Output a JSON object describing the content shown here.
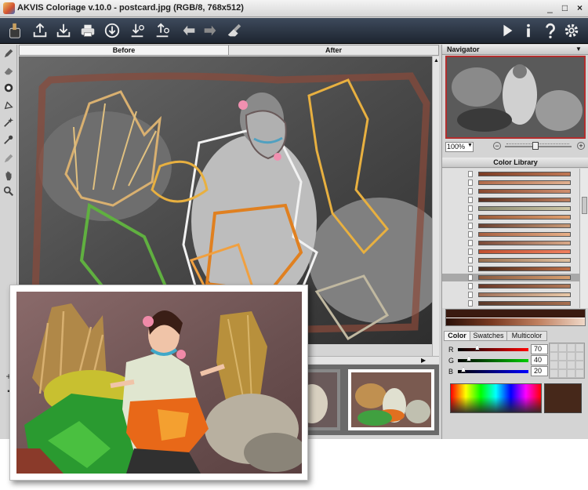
{
  "window": {
    "title": "AKVIS Coloriage v.10.0 - postcard.jpg (RGB/8, 768x512)",
    "controls": [
      "_",
      "□",
      "×"
    ]
  },
  "toolbar": {
    "buttons": [
      "open-icon",
      "save-icon",
      "print-icon",
      "share-icon",
      "import-strokes-icon",
      "export-strokes-icon",
      "undo-icon",
      "redo-icon",
      "clear-icon",
      "run-icon",
      "info-icon",
      "help-icon",
      "settings-icon"
    ]
  },
  "tools": [
    "pencil-icon",
    "eraser-icon",
    "color-pick-icon",
    "fill-icon",
    "magic-tube-icon",
    "eyedropper-icon",
    "keep-color-icon",
    "hand-icon",
    "zoom-icon"
  ],
  "view_tabs": {
    "before": "Before",
    "after": "After"
  },
  "navigator": {
    "title": "Navigator",
    "zoom": "100%"
  },
  "library": {
    "title": "Color Library",
    "swatches": [
      [
        "#7a3a22",
        "#c07855"
      ],
      [
        "#b06a4a",
        "#e0b090"
      ],
      [
        "#8a4a30",
        "#d09070"
      ],
      [
        "#5a3020",
        "#c08060"
      ],
      [
        "#8a8a70",
        "#d0c8a8"
      ],
      [
        "#9a5a38",
        "#e0a070"
      ],
      [
        "#6a4030",
        "#c89a78"
      ],
      [
        "#a86040",
        "#e8b088"
      ],
      [
        "#7a4a38",
        "#d8a888"
      ],
      [
        "#c05030",
        "#f08060"
      ],
      [
        "#9a7050",
        "#e0c0a0"
      ],
      [
        "#4a2818",
        "#c07048"
      ],
      [
        "#8a5a40",
        "#d8a070"
      ],
      [
        "#6a3828",
        "#b07858"
      ],
      [
        "#a07058",
        "#e8c8a8"
      ],
      [
        "#5a3828",
        "#a87050"
      ]
    ],
    "selected_row": 12
  },
  "color": {
    "tabs": [
      "Color",
      "Swatches",
      "Multicolor"
    ],
    "active_tab": "Color",
    "r": {
      "label": "R",
      "value": 70
    },
    "g": {
      "label": "G",
      "value": 40
    },
    "b": {
      "label": "B",
      "value": 20
    },
    "current": "#46281a"
  }
}
